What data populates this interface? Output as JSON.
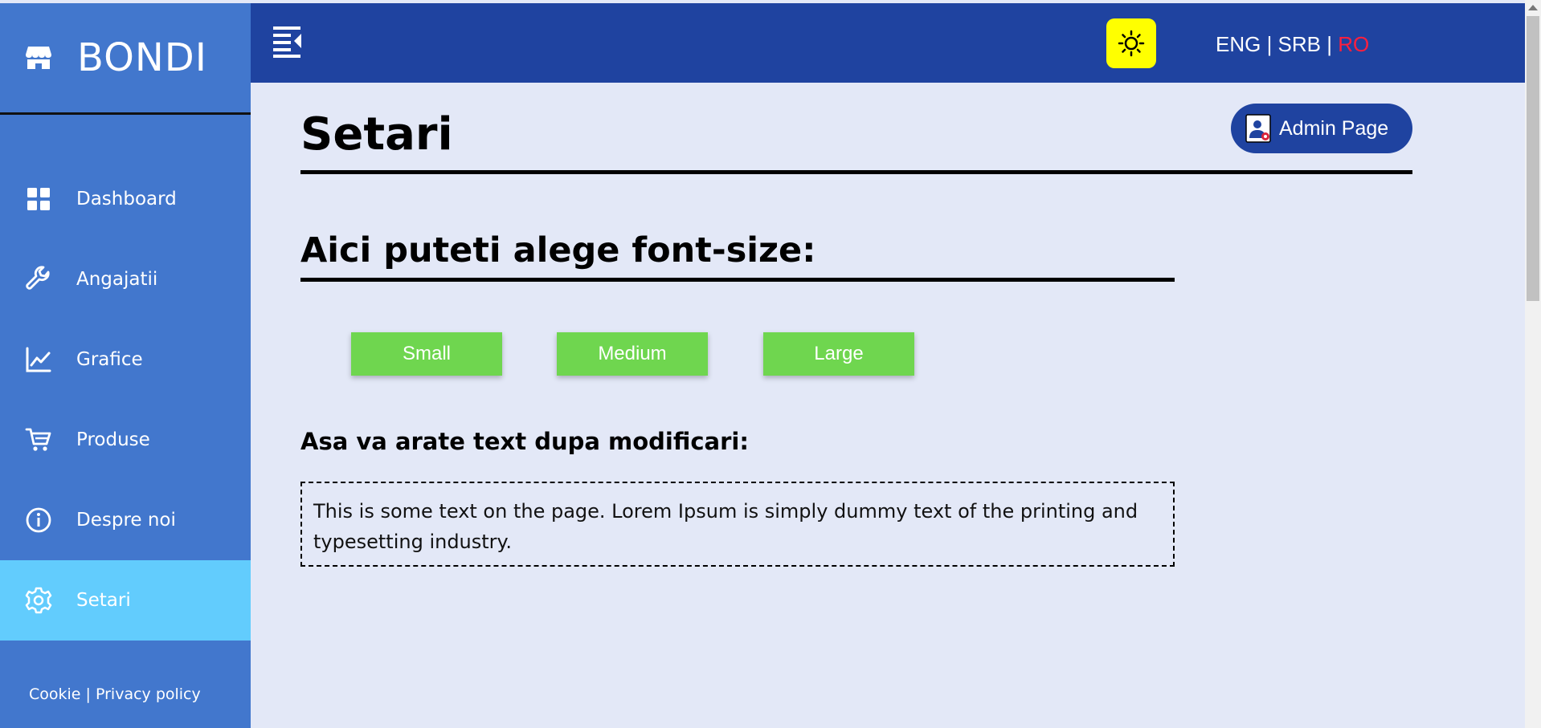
{
  "sidebar": {
    "brand": "BONDI",
    "items": [
      {
        "label": "Dashboard",
        "icon": "dashboard-icon"
      },
      {
        "label": "Angajatii",
        "icon": "wrench-icon"
      },
      {
        "label": "Grafice",
        "icon": "chart-line-icon"
      },
      {
        "label": "Produse",
        "icon": "cart-icon"
      },
      {
        "label": "Despre noi",
        "icon": "info-icon"
      },
      {
        "label": "Setari",
        "icon": "gear-icon",
        "active": true
      }
    ],
    "footer": {
      "cookie": "Cookie",
      "separator": " | ",
      "privacy": "Privacy policy"
    }
  },
  "topbar": {
    "languages": [
      "ENG",
      "SRB",
      "RO"
    ],
    "active_language": "RO",
    "separator": " | "
  },
  "main": {
    "title": "Setari",
    "admin_button": "Admin Page",
    "font_section_title": "Aici puteti alege font-size:",
    "size_buttons": [
      "Small",
      "Medium",
      "Large"
    ],
    "preview_label": "Asa va arate text dupa modificari:",
    "preview_text": "This is some text on the page. Lorem Ipsum is simply dummy text of the printing and typesetting industry."
  },
  "colors": {
    "sidebar": "#4277cd",
    "sidebar_active": "#62ccfd",
    "topbar": "#1f43a0",
    "content_bg": "#e3e8f7",
    "theme_toggle": "#ffff00",
    "size_button": "#6fd64f",
    "active_language": "#ff1f3d"
  }
}
